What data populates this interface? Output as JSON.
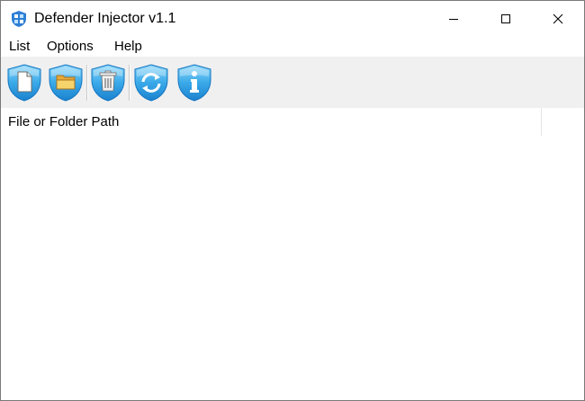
{
  "window": {
    "title": "Defender Injector v1.1",
    "icon": "defender-shield-icon"
  },
  "controls": {
    "minimize_icon": "minimize-icon",
    "maximize_icon": "maximize-icon",
    "close_icon": "close-icon"
  },
  "menu": {
    "items": [
      {
        "label": "List"
      },
      {
        "label": "Options"
      },
      {
        "label": "Help"
      }
    ]
  },
  "toolbar": {
    "buttons": [
      {
        "icon": "add-file-icon"
      },
      {
        "icon": "add-folder-icon"
      },
      {
        "icon": "delete-icon"
      },
      {
        "icon": "refresh-icon"
      },
      {
        "icon": "info-icon"
      }
    ]
  },
  "list": {
    "columns": [
      "File or Folder Path"
    ],
    "rows": []
  },
  "colors": {
    "shield_blue": "#2e9ee3",
    "shield_light": "#7fd0f5",
    "toolbar_bg": "#f0f0f0"
  }
}
